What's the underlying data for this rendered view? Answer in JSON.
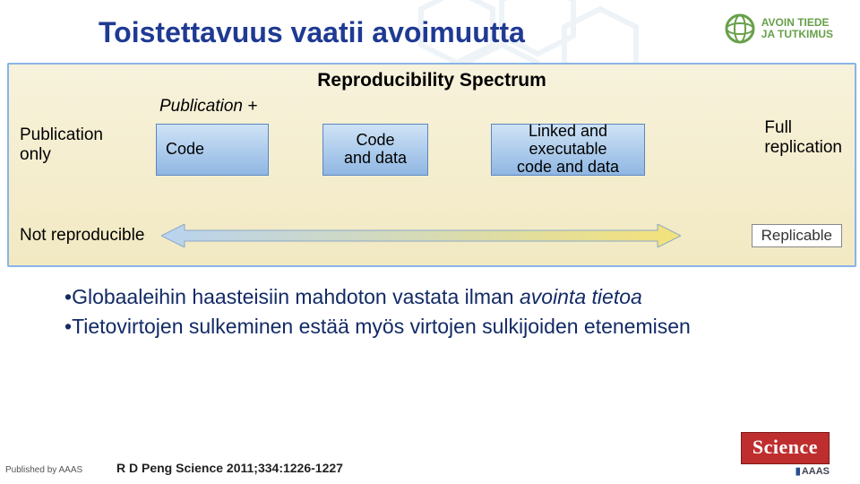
{
  "title": "Toistettavuus vaatii avoimuutta",
  "logo_top": {
    "line1": "AVOIN TIEDE",
    "line2": "JA TUTKIMUS"
  },
  "spectrum": {
    "heading": "Reproducibility Spectrum",
    "publication_plus": "Publication +",
    "left_lbl_l1": "Publication",
    "left_lbl_l2": "only",
    "right_lbl_l1": "Full",
    "right_lbl_l2": "replication",
    "not_reproducible": "Not reproducible",
    "replicable_box": "Replicable",
    "stage1": "Code",
    "stage2_l1": "Code",
    "stage2_l2": "and data",
    "stage3_l1": "Linked and",
    "stage3_l2": "executable",
    "stage3_l3": "code and data"
  },
  "bullets": {
    "b1_pre": "Globaaleihin haasteisiin mahdoton vastata ilman ",
    "b1_it": "avointa tietoa",
    "b2": "Tietovirtojen sulkeminen estää myös virtojen sulkijoiden etenemisen"
  },
  "footer": {
    "published": "Published by AAAS",
    "citation": "R D Peng Science 2011;334:1226-1227",
    "science": "Science",
    "aaas": "AAAS"
  },
  "colors": {
    "title": "#1f3a93",
    "accent": "#bf2e2e"
  }
}
